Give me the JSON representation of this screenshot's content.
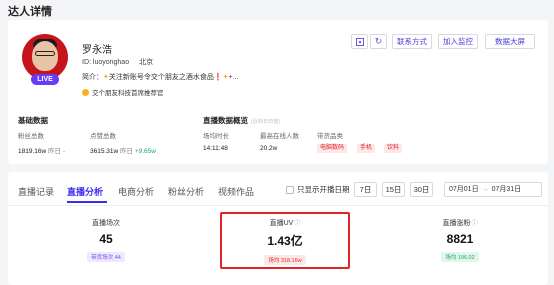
{
  "page_title": "达人详情",
  "profile": {
    "name": "罗永浩",
    "id_text": "ID: luoyonghao",
    "location": "北京",
    "live_badge": "LIVE",
    "bio_prefix": "简介：",
    "bio_text": "关注新账号令交个朋友之酒水食品",
    "bio_suffix": "+...",
    "tagline": "交个朋友科技首席推荐官"
  },
  "actions": {
    "contact_label": "联系方式",
    "monitor_label": "加入监控",
    "screen_label": "数据大屏",
    "qr_icon": "qr-code-icon",
    "refresh_icon": "refresh-icon"
  },
  "basic": {
    "title": "基础数据",
    "fans_label": "粉丝总数",
    "fans_value": "1819.16w",
    "fans_suffix": "昨日 -",
    "likes_label": "点赞总数",
    "likes_value": "3615.31w",
    "likes_change_label": "昨日",
    "likes_change": "+9.65w"
  },
  "live_overview": {
    "title": "直播数据概览",
    "subtitle": "(近30日均值)",
    "duration_label": "场均时长",
    "duration_value": "14:11:48",
    "peak_label": "最高在线人数",
    "peak_value": "20.2w",
    "category_label": "带货品类",
    "categories": [
      "电脑数码",
      "手机",
      "饮料"
    ]
  },
  "tabs": [
    {
      "label": "直播记录",
      "active": false
    },
    {
      "label": "直播分析",
      "active": true
    },
    {
      "label": "电商分析",
      "active": false
    },
    {
      "label": "粉丝分析",
      "active": false
    },
    {
      "label": "视频作品",
      "active": false
    }
  ],
  "filters": {
    "checkbox_label": "只显示开播日期",
    "day_options": [
      "7日",
      "15日",
      "30日"
    ],
    "date_start": "07月01日",
    "date_end": "07月31日",
    "calendar_icon": "calendar-icon"
  },
  "metrics": [
    {
      "label": "直播场次",
      "value": "45",
      "sub": "带货场次 44",
      "color": "#7a47e8"
    },
    {
      "label": "直播UV",
      "value": "1.43亿",
      "sub": "场均 318.16w",
      "color": "#e3262e"
    },
    {
      "label": "直播涨粉",
      "value": "8821",
      "sub": "场均 196.02",
      "color": "#17a968"
    }
  ],
  "colors": {
    "accent": "#3a2cf0",
    "highlight": "#e32424",
    "live_badge": "#6a3bf7"
  }
}
